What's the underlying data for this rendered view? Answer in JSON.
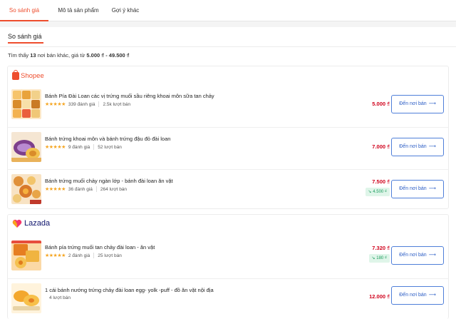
{
  "tabs": [
    {
      "label": "So sánh giá"
    },
    {
      "label": "Mô tả sản phẩm"
    },
    {
      "label": "Gợi ý khác"
    }
  ],
  "section": {
    "title": "So sánh giá"
  },
  "summary": {
    "prefix": "Tìm thấy ",
    "count": "13",
    "middle": " nơi bán khác, giá từ ",
    "range": "5.000 ₫ - 49.500 ₫"
  },
  "shops": [
    {
      "name": "Shopee",
      "logo_icon": "shopee-bag-icon",
      "products": [
        {
          "name": "Bánh Pía Đài Loan các vị trứng muối sầu riêng khoai môn sữa tan chảy",
          "rating": "★★★★★",
          "reviews": "339 đánh giá",
          "sold": "2.5k lượt bán",
          "price": "5.000 ₫",
          "drop": "",
          "button": "Đến nơi bán"
        },
        {
          "name": "Bánh trứng khoai môn và bánh trứng đậu đỏ đài loan",
          "rating": "★★★★★",
          "reviews": "9 đánh giá",
          "sold": "52 lượt bán",
          "price": "7.000 ₫",
          "drop": "",
          "button": "Đến nơi bán"
        },
        {
          "name": "Bánh trứng muối chảy ngàn lớp - bánh đài loan ăn vặt",
          "rating": "★★★★★",
          "reviews": "36 đánh giá",
          "sold": "264 lượt bán",
          "price": "7.500 ₫",
          "drop": "4.500 ₫",
          "button": "Đến nơi bán"
        }
      ]
    },
    {
      "name": "Lazada",
      "logo_icon": "lazada-heart-icon",
      "products": [
        {
          "name": "Bánh pía trứng muối tan chảy đài loan - ăn vặt",
          "rating": "★★★★★",
          "reviews": "2 đánh giá",
          "sold": "25 lượt bán",
          "price": "7.320 ₫",
          "drop": "180 ₫",
          "button": "Đến nơi bán"
        },
        {
          "name": "1 cái bánh nướng trứng chảy đài loan egg- yolk -puff - đồ ăn vặt nội địa",
          "rating": "",
          "reviews": "",
          "sold": "4 lượt bán",
          "price": "12.000 ₫",
          "drop": "",
          "button": "Đến nơi bán"
        }
      ]
    }
  ],
  "colors": {
    "accent": "#ee4d2d",
    "price": "#d0011b",
    "button": "#2a5cc5",
    "drop": "#1a9c5c",
    "lazada": "#0f146d"
  }
}
